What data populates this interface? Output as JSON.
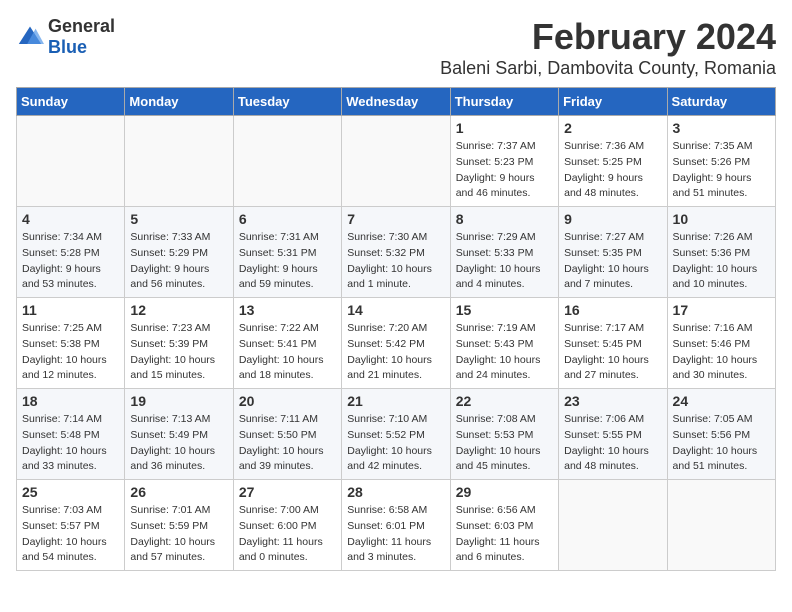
{
  "logo": {
    "text_general": "General",
    "text_blue": "Blue"
  },
  "title": "February 2024",
  "subtitle": "Baleni Sarbi, Dambovita County, Romania",
  "days_of_week": [
    "Sunday",
    "Monday",
    "Tuesday",
    "Wednesday",
    "Thursday",
    "Friday",
    "Saturday"
  ],
  "weeks": [
    [
      {
        "day": "",
        "info": ""
      },
      {
        "day": "",
        "info": ""
      },
      {
        "day": "",
        "info": ""
      },
      {
        "day": "",
        "info": ""
      },
      {
        "day": "1",
        "info": "Sunrise: 7:37 AM\nSunset: 5:23 PM\nDaylight: 9 hours\nand 46 minutes."
      },
      {
        "day": "2",
        "info": "Sunrise: 7:36 AM\nSunset: 5:25 PM\nDaylight: 9 hours\nand 48 minutes."
      },
      {
        "day": "3",
        "info": "Sunrise: 7:35 AM\nSunset: 5:26 PM\nDaylight: 9 hours\nand 51 minutes."
      }
    ],
    [
      {
        "day": "4",
        "info": "Sunrise: 7:34 AM\nSunset: 5:28 PM\nDaylight: 9 hours\nand 53 minutes."
      },
      {
        "day": "5",
        "info": "Sunrise: 7:33 AM\nSunset: 5:29 PM\nDaylight: 9 hours\nand 56 minutes."
      },
      {
        "day": "6",
        "info": "Sunrise: 7:31 AM\nSunset: 5:31 PM\nDaylight: 9 hours\nand 59 minutes."
      },
      {
        "day": "7",
        "info": "Sunrise: 7:30 AM\nSunset: 5:32 PM\nDaylight: 10 hours\nand 1 minute."
      },
      {
        "day": "8",
        "info": "Sunrise: 7:29 AM\nSunset: 5:33 PM\nDaylight: 10 hours\nand 4 minutes."
      },
      {
        "day": "9",
        "info": "Sunrise: 7:27 AM\nSunset: 5:35 PM\nDaylight: 10 hours\nand 7 minutes."
      },
      {
        "day": "10",
        "info": "Sunrise: 7:26 AM\nSunset: 5:36 PM\nDaylight: 10 hours\nand 10 minutes."
      }
    ],
    [
      {
        "day": "11",
        "info": "Sunrise: 7:25 AM\nSunset: 5:38 PM\nDaylight: 10 hours\nand 12 minutes."
      },
      {
        "day": "12",
        "info": "Sunrise: 7:23 AM\nSunset: 5:39 PM\nDaylight: 10 hours\nand 15 minutes."
      },
      {
        "day": "13",
        "info": "Sunrise: 7:22 AM\nSunset: 5:41 PM\nDaylight: 10 hours\nand 18 minutes."
      },
      {
        "day": "14",
        "info": "Sunrise: 7:20 AM\nSunset: 5:42 PM\nDaylight: 10 hours\nand 21 minutes."
      },
      {
        "day": "15",
        "info": "Sunrise: 7:19 AM\nSunset: 5:43 PM\nDaylight: 10 hours\nand 24 minutes."
      },
      {
        "day": "16",
        "info": "Sunrise: 7:17 AM\nSunset: 5:45 PM\nDaylight: 10 hours\nand 27 minutes."
      },
      {
        "day": "17",
        "info": "Sunrise: 7:16 AM\nSunset: 5:46 PM\nDaylight: 10 hours\nand 30 minutes."
      }
    ],
    [
      {
        "day": "18",
        "info": "Sunrise: 7:14 AM\nSunset: 5:48 PM\nDaylight: 10 hours\nand 33 minutes."
      },
      {
        "day": "19",
        "info": "Sunrise: 7:13 AM\nSunset: 5:49 PM\nDaylight: 10 hours\nand 36 minutes."
      },
      {
        "day": "20",
        "info": "Sunrise: 7:11 AM\nSunset: 5:50 PM\nDaylight: 10 hours\nand 39 minutes."
      },
      {
        "day": "21",
        "info": "Sunrise: 7:10 AM\nSunset: 5:52 PM\nDaylight: 10 hours\nand 42 minutes."
      },
      {
        "day": "22",
        "info": "Sunrise: 7:08 AM\nSunset: 5:53 PM\nDaylight: 10 hours\nand 45 minutes."
      },
      {
        "day": "23",
        "info": "Sunrise: 7:06 AM\nSunset: 5:55 PM\nDaylight: 10 hours\nand 48 minutes."
      },
      {
        "day": "24",
        "info": "Sunrise: 7:05 AM\nSunset: 5:56 PM\nDaylight: 10 hours\nand 51 minutes."
      }
    ],
    [
      {
        "day": "25",
        "info": "Sunrise: 7:03 AM\nSunset: 5:57 PM\nDaylight: 10 hours\nand 54 minutes."
      },
      {
        "day": "26",
        "info": "Sunrise: 7:01 AM\nSunset: 5:59 PM\nDaylight: 10 hours\nand 57 minutes."
      },
      {
        "day": "27",
        "info": "Sunrise: 7:00 AM\nSunset: 6:00 PM\nDaylight: 11 hours\nand 0 minutes."
      },
      {
        "day": "28",
        "info": "Sunrise: 6:58 AM\nSunset: 6:01 PM\nDaylight: 11 hours\nand 3 minutes."
      },
      {
        "day": "29",
        "info": "Sunrise: 6:56 AM\nSunset: 6:03 PM\nDaylight: 11 hours\nand 6 minutes."
      },
      {
        "day": "",
        "info": ""
      },
      {
        "day": "",
        "info": ""
      }
    ]
  ]
}
